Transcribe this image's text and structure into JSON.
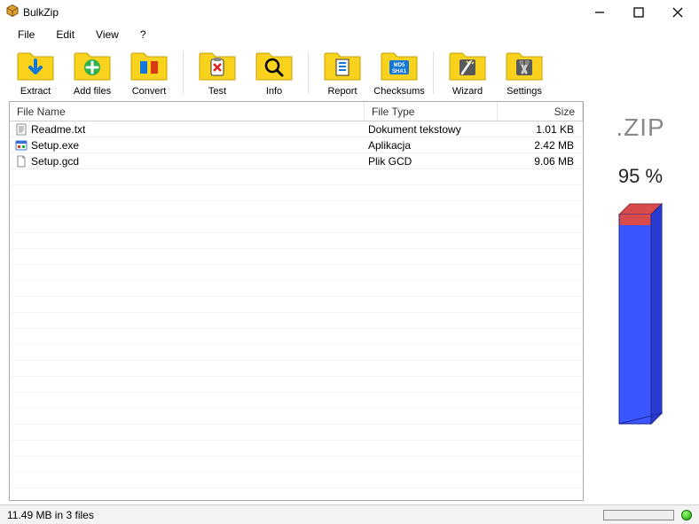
{
  "window": {
    "title": "BulkZip"
  },
  "menubar": {
    "items": [
      "File",
      "Edit",
      "View",
      "?"
    ]
  },
  "toolbar": {
    "buttons": [
      {
        "label": "Extract",
        "icon": "extract"
      },
      {
        "label": "Add files",
        "icon": "add"
      },
      {
        "label": "Convert",
        "icon": "convert"
      },
      {
        "label": "Test",
        "icon": "test"
      },
      {
        "label": "Info",
        "icon": "info"
      },
      {
        "label": "Report",
        "icon": "report"
      },
      {
        "label": "Checksums",
        "icon": "checksums"
      },
      {
        "label": "Wizard",
        "icon": "wizard"
      },
      {
        "label": "Settings",
        "icon": "settings"
      }
    ]
  },
  "listview": {
    "columns": {
      "name": "File Name",
      "type": "File Type",
      "size": "Size"
    },
    "rows": [
      {
        "name": "Readme.txt",
        "type": "Dokument tekstowy",
        "size": "1.01 KB",
        "icon": "txt"
      },
      {
        "name": "Setup.exe",
        "type": "Aplikacja",
        "size": "2.42 MB",
        "icon": "exe"
      },
      {
        "name": "Setup.gcd",
        "type": "Plik GCD",
        "size": "9.06 MB",
        "icon": "generic"
      }
    ]
  },
  "sidepanel": {
    "format_label": ".ZIP",
    "percent_label": "95 %"
  },
  "statusbar": {
    "summary": "11.49 MB in 3 files"
  }
}
